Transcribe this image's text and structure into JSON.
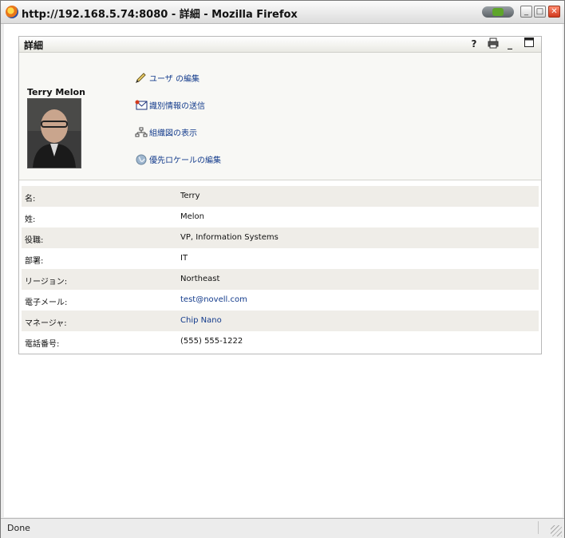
{
  "window": {
    "title": "http://192.168.5.74:8080 - 詳細 - Mozilla Firefox",
    "status": "Done"
  },
  "portlet": {
    "title": "詳細",
    "controls": {
      "help": "?",
      "minimize": "_"
    }
  },
  "user": {
    "name": "Terry Melon"
  },
  "actions": [
    {
      "label": "ユーザ の編集",
      "icon": "pencil-icon"
    },
    {
      "label": "識別情報の送信",
      "icon": "mail-icon"
    },
    {
      "label": "組織図の表示",
      "icon": "org-chart-icon"
    },
    {
      "label": "優先ロケールの編集",
      "icon": "globe-icon"
    }
  ],
  "details": [
    {
      "label": "名:",
      "value": "Terry"
    },
    {
      "label": "姓:",
      "value": "Melon"
    },
    {
      "label": "役職:",
      "value": "VP, Information Systems"
    },
    {
      "label": "部署:",
      "value": "IT"
    },
    {
      "label": "リージョン:",
      "value": "Northeast"
    },
    {
      "label": "電子メール:",
      "value": "test@novell.com",
      "link": true
    },
    {
      "label": "マネージャ:",
      "value": "Chip Nano",
      "link": true
    },
    {
      "label": "電話番号:",
      "value": "(555) 555-1222"
    }
  ],
  "colors": {
    "link": "#133b8c",
    "alt_row": "#efede8",
    "summary_bg": "#f8f8f5"
  }
}
